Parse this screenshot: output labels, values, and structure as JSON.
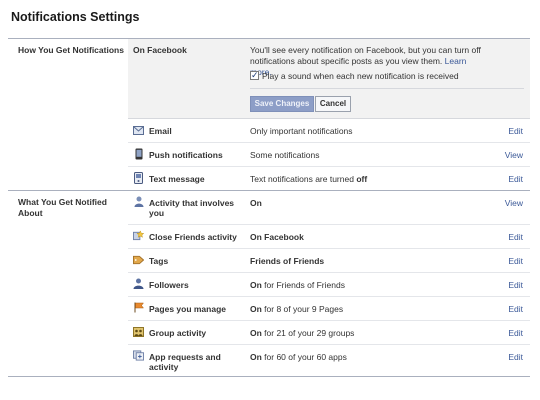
{
  "page": {
    "title": "Notifications Settings"
  },
  "how": {
    "label": "How You Get Notifications",
    "on_facebook": {
      "label": "On Facebook",
      "description": "You'll see every notification on Facebook, but you can turn off notifications about specific posts as you view them.",
      "learn_more": "Learn more.",
      "sound_checkbox": {
        "label": "Play a sound when each new notification is received",
        "checked": true
      },
      "save_button": "Save Changes",
      "cancel_button": "Cancel"
    },
    "rows": [
      {
        "icon": "envelope-icon",
        "label": "Email",
        "value_plain": "Only important notifications",
        "value_bold": "",
        "value_suffix": "",
        "action": "Edit"
      },
      {
        "icon": "mobile-phone-icon",
        "label": "Push notifications",
        "value_plain": "Some notifications",
        "value_bold": "",
        "value_suffix": "",
        "action": "View"
      },
      {
        "icon": "sms-phone-icon",
        "label": "Text message",
        "value_plain": "Text notifications are turned ",
        "value_bold": "off",
        "value_suffix": "",
        "action": "Edit"
      }
    ]
  },
  "what": {
    "label": "What You Get Notified About",
    "rows": [
      {
        "icon": "person-icon",
        "label": "Activity that involves you",
        "value_plain": "",
        "value_bold": "On",
        "value_suffix": "",
        "action": "View"
      },
      {
        "icon": "star-friends-icon",
        "label": "Close Friends activity",
        "value_plain": "",
        "value_bold": "On Facebook",
        "value_suffix": "",
        "action": "Edit"
      },
      {
        "icon": "tag-icon",
        "label": "Tags",
        "value_plain": "",
        "value_bold": "Friends of Friends",
        "value_suffix": "",
        "action": "Edit"
      },
      {
        "icon": "followers-icon",
        "label": "Followers",
        "value_plain": "",
        "value_bold": "On",
        "value_suffix": " for Friends of Friends",
        "action": "Edit"
      },
      {
        "icon": "flag-pages-icon",
        "label": "Pages you manage",
        "value_plain": "",
        "value_bold": "On",
        "value_suffix": " for 8 of your 9 Pages",
        "action": "Edit"
      },
      {
        "icon": "group-icon",
        "label": "Group activity",
        "value_plain": "",
        "value_bold": "On",
        "value_suffix": " for 21 of your 29 groups",
        "action": "Edit"
      },
      {
        "icon": "app-requests-icon",
        "label": "App requests and activity",
        "value_plain": "",
        "value_bold": "On",
        "value_suffix": " for 60 of your 60 apps",
        "action": "Edit"
      }
    ]
  },
  "colors": {
    "link": "#3b5998",
    "panel": "#f2f2f2",
    "rule": "#aab0be"
  }
}
